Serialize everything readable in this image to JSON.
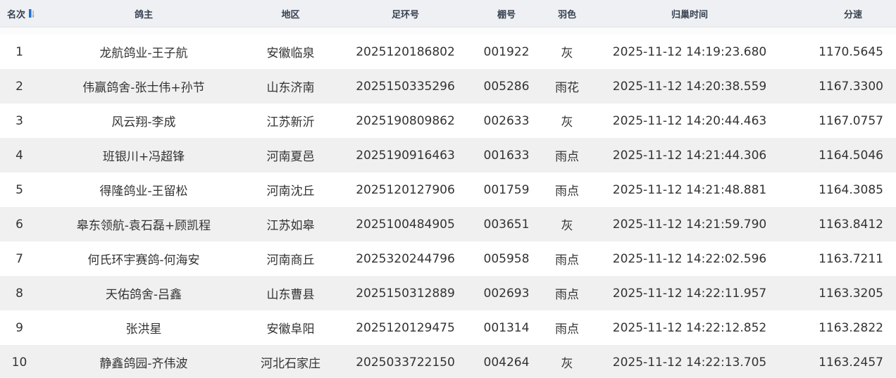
{
  "headers": {
    "rank": "名次",
    "owner": "鸽主",
    "region": "地区",
    "ring": "足环号",
    "shed": "棚号",
    "color": "羽色",
    "time": "归巢时间",
    "speed": "分速"
  },
  "sort": {
    "icon": "sort-arrows-icon",
    "accent": "#1e6fd9"
  },
  "colors": {
    "header_bg": "#eef0f3",
    "row_alt": "#f0f0f0",
    "row": "#ffffff",
    "text": "#333333"
  },
  "rows": [
    {
      "rank": "1",
      "owner": "龙航鸽业-王子航",
      "region": "安徽临泉",
      "ring": "2025120186802",
      "shed": "001922",
      "color": "灰",
      "time": "2025-11-12 14:19:23.680",
      "speed": "1170.5645"
    },
    {
      "rank": "2",
      "owner": "伟赢鸽舍-张士伟+孙节",
      "region": "山东济南",
      "ring": "2025150335296",
      "shed": "005286",
      "color": "雨花",
      "time": "2025-11-12 14:20:38.559",
      "speed": "1167.3300"
    },
    {
      "rank": "3",
      "owner": "风云翔-李成",
      "region": "江苏新沂",
      "ring": "2025190809862",
      "shed": "002633",
      "color": "灰",
      "time": "2025-11-12 14:20:44.463",
      "speed": "1167.0757"
    },
    {
      "rank": "4",
      "owner": "班银川+冯超锋",
      "region": "河南夏邑",
      "ring": "2025190916463",
      "shed": "001633",
      "color": "雨点",
      "time": "2025-11-12 14:21:44.306",
      "speed": "1164.5046"
    },
    {
      "rank": "5",
      "owner": "得隆鸽业-王留松",
      "region": "河南沈丘",
      "ring": "2025120127906",
      "shed": "001759",
      "color": "雨点",
      "time": "2025-11-12 14:21:48.881",
      "speed": "1164.3085"
    },
    {
      "rank": "6",
      "owner": "皋东领航-袁石磊+顾凯程",
      "region": "江苏如皋",
      "ring": "2025100484905",
      "shed": "003651",
      "color": "灰",
      "time": "2025-11-12 14:21:59.790",
      "speed": "1163.8412"
    },
    {
      "rank": "7",
      "owner": "何氏环宇赛鸽-何海安",
      "region": "河南商丘",
      "ring": "2025320244796",
      "shed": "005958",
      "color": "雨点",
      "time": "2025-11-12 14:22:02.596",
      "speed": "1163.7211"
    },
    {
      "rank": "8",
      "owner": "天佑鸽舍-吕鑫",
      "region": "山东曹县",
      "ring": "2025150312889",
      "shed": "002693",
      "color": "雨点",
      "time": "2025-11-12 14:22:11.957",
      "speed": "1163.3205"
    },
    {
      "rank": "9",
      "owner": "张洪星",
      "region": "安徽阜阳",
      "ring": "2025120129475",
      "shed": "001314",
      "color": "雨点",
      "time": "2025-11-12 14:22:12.852",
      "speed": "1163.2822"
    },
    {
      "rank": "10",
      "owner": "静鑫鸽园-齐伟波",
      "region": "河北石家庄",
      "ring": "2025033722150",
      "shed": "004264",
      "color": "灰",
      "time": "2025-11-12 14:22:13.705",
      "speed": "1163.2457"
    }
  ]
}
